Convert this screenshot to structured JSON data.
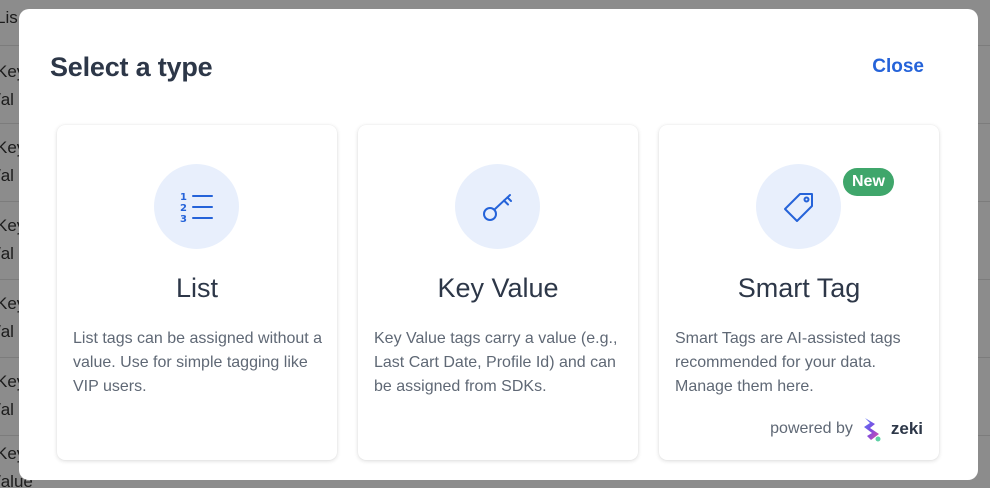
{
  "background": {
    "rows": [
      {
        "text": "Lis"
      },
      {
        "text": "Key"
      },
      {
        "text": "/al"
      },
      {
        "text": "Key"
      },
      {
        "text": "/al"
      },
      {
        "text": "Key"
      },
      {
        "text": "/al"
      },
      {
        "text": "Key"
      },
      {
        "text": "/al"
      },
      {
        "text": "Key"
      },
      {
        "text": "/al"
      },
      {
        "text": "Key"
      },
      {
        "text": "/alue"
      }
    ]
  },
  "modal": {
    "title": "Select a type",
    "close_label": "Close"
  },
  "cards": [
    {
      "icon": "numbered-list-icon",
      "title": "List",
      "description": "List tags can be assigned without a value. Use for simple tagging like VIP users."
    },
    {
      "icon": "key-icon",
      "title": "Key Value",
      "description": "Key Value tags carry a value (e.g., Last Cart Date, Profile Id) and can be assigned from SDKs."
    },
    {
      "icon": "tag-icon",
      "title": "Smart Tag",
      "badge": "New",
      "description": "Smart Tags are AI-assisted tags recommended for your data. Manage them here.",
      "powered_by": "powered by",
      "brand": "zeki"
    }
  ],
  "colors": {
    "accent": "#2563d9",
    "badge": "#3fa66b",
    "icon_bg": "#e8effc"
  }
}
